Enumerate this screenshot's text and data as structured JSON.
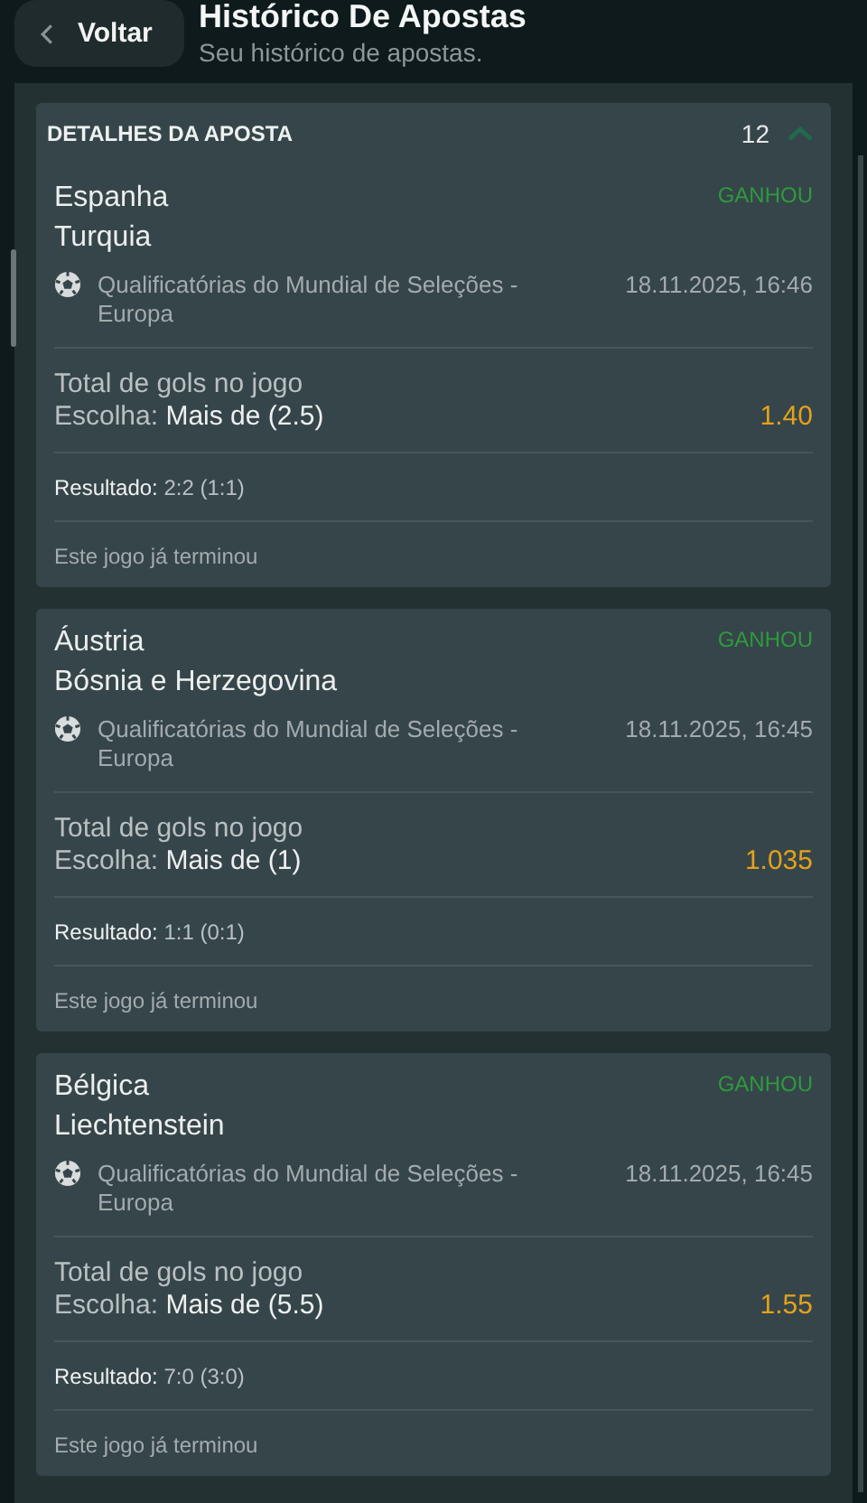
{
  "header": {
    "back_button": "Voltar",
    "title": "Histórico De Apostas",
    "subtitle": "Seu histórico de apostas."
  },
  "details": {
    "title": "DETALHES DA APOSTA",
    "count": "12",
    "expanded": true
  },
  "bets": [
    {
      "team_home": "Espanha",
      "team_away": "Turquia",
      "status": "GANHOU",
      "kind": "won",
      "league": "Qualificatórias do Mundial de Seleções - Europa",
      "date": "18.11.2025, 16:46",
      "market": "Total de gols no jogo",
      "choice": "Escolha: **Mais de (2.5)**",
      "odd": "1.40",
      "result": "**Resultado:** 2:2 (1:1)",
      "note": "Este jogo já terminou"
    },
    {
      "team_home": "Áustria",
      "team_away": "Bósnia e Herzegovina",
      "status": "GANHOU",
      "kind": "won",
      "league": "Qualificatórias do Mundial de Seleções - Europa",
      "date": "18.11.2025, 16:45",
      "market": "Total de gols no jogo",
      "choice": "Escolha: **Mais de (1)**",
      "odd": "1.035",
      "result": "**Resultado:** 1:1 (0:1)",
      "note": "Este jogo já terminou"
    },
    {
      "team_home": "Bélgica",
      "team_away": "Liechtenstein",
      "status": "GANHOU",
      "kind": "won",
      "league": "Qualificatórias do Mundial de Seleções - Europa",
      "date": "18.11.2025, 16:45",
      "market": "Total de gols no jogo",
      "choice": "Escolha: **Mais de (5.5)**",
      "odd": "1.55",
      "result": "**Resultado:** 7:0 (3:0)",
      "note": "Este jogo já terminou"
    }
  ]
}
